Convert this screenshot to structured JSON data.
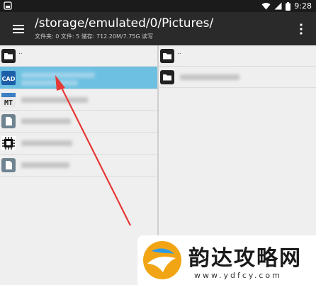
{
  "status_bar": {
    "time": "9:28",
    "icons": [
      "wifi-icon",
      "signal-icon",
      "battery-icon"
    ]
  },
  "toolbar": {
    "path": "/storage/emulated/0/Pictures/",
    "info": "文件夹: 0  文件: 5  储存: 712.20M/7.75G  读写",
    "menu_icon": "hamburger-icon",
    "overflow_icon": "more-vert-icon"
  },
  "left_pane": {
    "items": [
      {
        "label": "..",
        "icon": "folder-icon"
      },
      {
        "label": "",
        "icon": "cad-app-icon",
        "selected": true
      },
      {
        "label": "",
        "icon": "mt-app-icon"
      },
      {
        "label": "",
        "icon": "file-icon"
      },
      {
        "label": "",
        "icon": "chip-icon"
      },
      {
        "label": "",
        "icon": "file-icon"
      }
    ]
  },
  "right_pane": {
    "items": [
      {
        "label": "..",
        "icon": "folder-icon"
      },
      {
        "label": "",
        "icon": "folder-icon"
      }
    ]
  },
  "watermark": {
    "title": "韵达攻略网",
    "url": "www.ydfcy.com"
  },
  "colors": {
    "selected": "#6dc0e1",
    "arrow": "#e53935",
    "toolbar": "#2a2a2a",
    "pane": "#efefef"
  }
}
